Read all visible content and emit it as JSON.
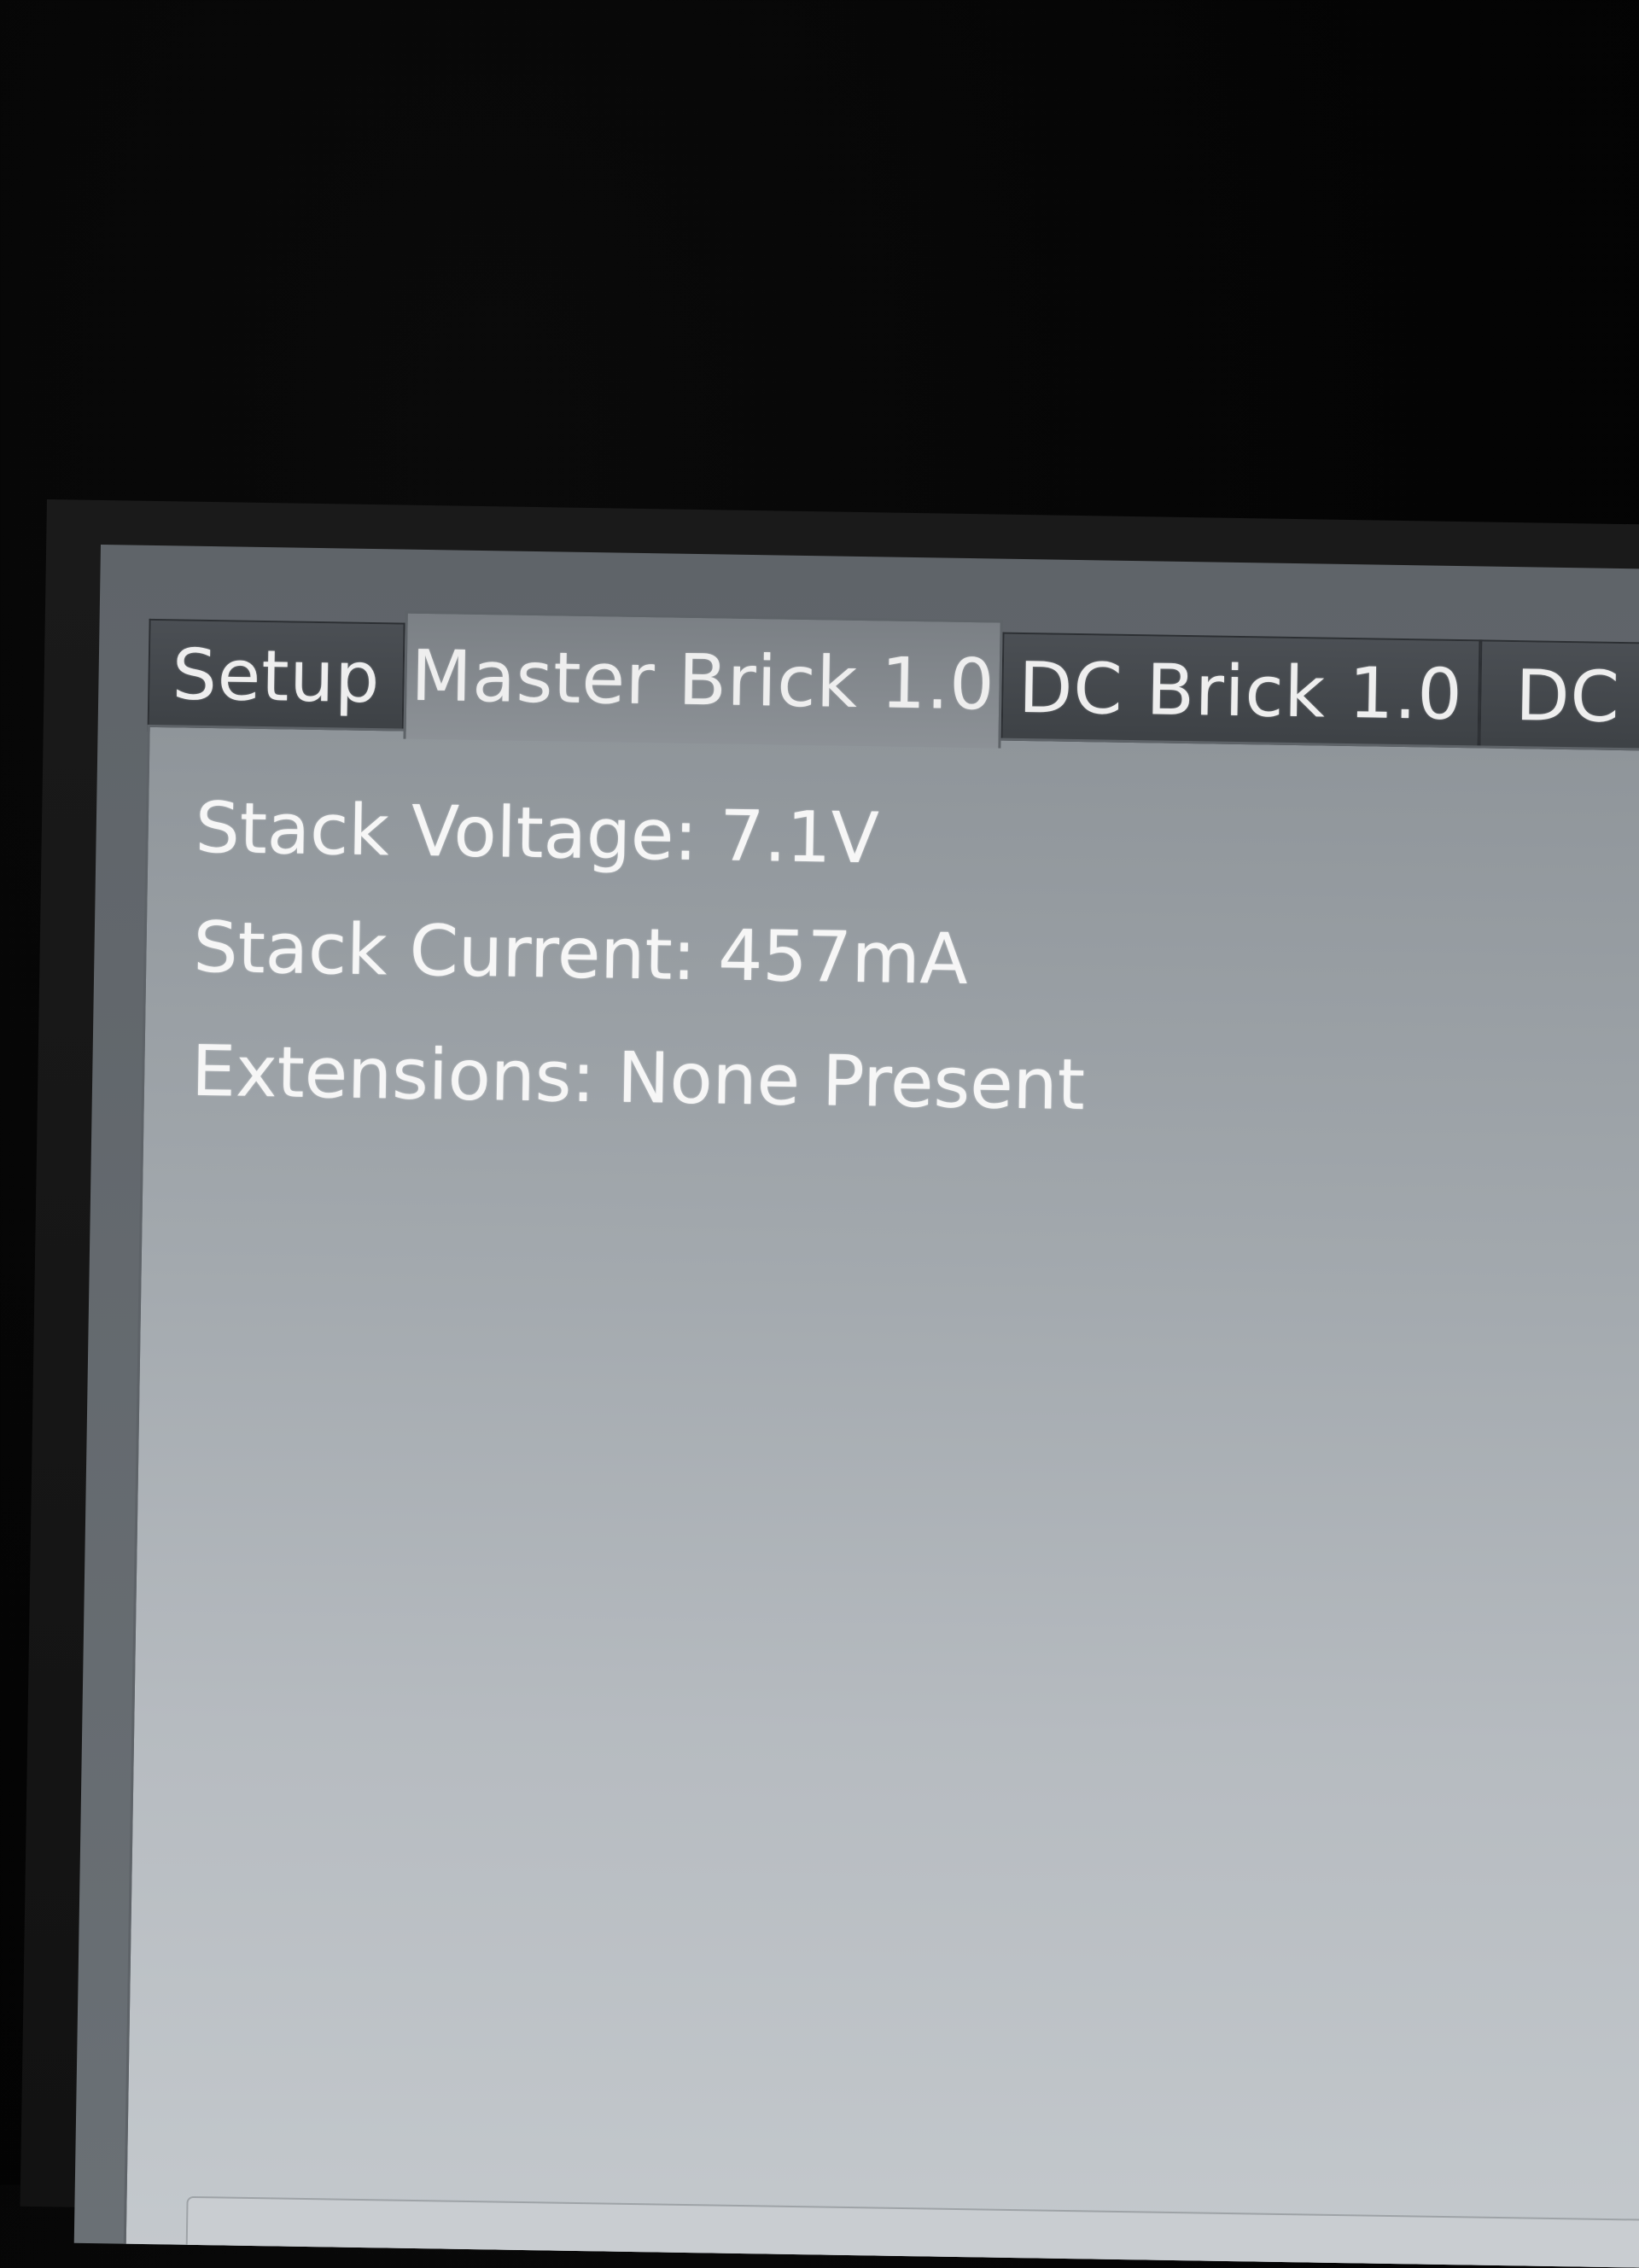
{
  "tabs": [
    {
      "label": "Setup",
      "active": false
    },
    {
      "label": "Master Brick 1.0",
      "active": true
    },
    {
      "label": "DC Brick 1.0",
      "active": false
    },
    {
      "label": "DC",
      "active": false
    }
  ],
  "master_brick": {
    "stack_voltage": "Stack Voltage: 7.1V",
    "stack_current": "Stack Current: 457mA",
    "extensions": "Extensions: None Present"
  }
}
